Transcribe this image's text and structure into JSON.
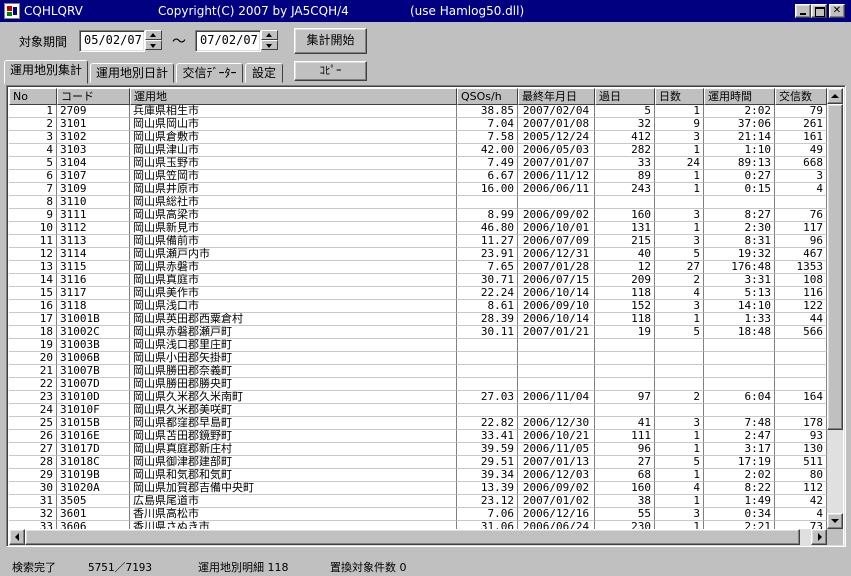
{
  "window": {
    "title": "CQHLQRV",
    "copyright": "Copyright(C) 2007  by  JA5CQH/4",
    "note": "(use Hamlog50.dll)"
  },
  "toolbar": {
    "period_label": "対象期間",
    "date_from": "05/02/07",
    "date_to": "07/02/07",
    "tilde": "～",
    "start_button": "集計開始",
    "copy_button": "ｺﾋﾟｰ"
  },
  "tabs": [
    {
      "label": "運用地別集計",
      "active": true
    },
    {
      "label": "運用地別日計",
      "active": false
    },
    {
      "label": "交信ﾃﾞｰﾀｰ",
      "active": false
    },
    {
      "label": "設定",
      "active": false
    }
  ],
  "table": {
    "columns": [
      "No",
      "コード",
      "運用地",
      "QSOs/h",
      "最終年月日",
      "過日",
      "日数",
      "運用時間",
      "交信数"
    ],
    "rows": [
      [
        "1",
        "2709",
        "兵庫県相生市",
        "38.85",
        "2007/02/04",
        "5",
        "1",
        "2:02",
        "79"
      ],
      [
        "2",
        "3101",
        "岡山県岡山市",
        "7.04",
        "2007/01/08",
        "32",
        "9",
        "37:06",
        "261"
      ],
      [
        "3",
        "3102",
        "岡山県倉敷市",
        "7.58",
        "2005/12/24",
        "412",
        "3",
        "21:14",
        "161"
      ],
      [
        "4",
        "3103",
        "岡山県津山市",
        "42.00",
        "2006/05/03",
        "282",
        "1",
        "1:10",
        "49"
      ],
      [
        "5",
        "3104",
        "岡山県玉野市",
        "7.49",
        "2007/01/07",
        "33",
        "24",
        "89:13",
        "668"
      ],
      [
        "6",
        "3107",
        "岡山県笠岡市",
        "6.67",
        "2006/11/12",
        "89",
        "1",
        "0:27",
        "3"
      ],
      [
        "7",
        "3109",
        "岡山県井原市",
        "16.00",
        "2006/06/11",
        "243",
        "1",
        "0:15",
        "4"
      ],
      [
        "8",
        "3110",
        "岡山県総社市",
        "",
        "",
        "",
        "",
        "",
        ""
      ],
      [
        "9",
        "3111",
        "岡山県高梁市",
        "8.99",
        "2006/09/02",
        "160",
        "3",
        "8:27",
        "76"
      ],
      [
        "10",
        "3112",
        "岡山県新見市",
        "46.80",
        "2006/10/01",
        "131",
        "1",
        "2:30",
        "117"
      ],
      [
        "11",
        "3113",
        "岡山県備前市",
        "11.27",
        "2006/07/09",
        "215",
        "3",
        "8:31",
        "96"
      ],
      [
        "12",
        "3114",
        "岡山県瀬戸内市",
        "23.91",
        "2006/12/31",
        "40",
        "5",
        "19:32",
        "467"
      ],
      [
        "13",
        "3115",
        "岡山県赤磐市",
        "7.65",
        "2007/01/28",
        "12",
        "27",
        "176:48",
        "1353"
      ],
      [
        "14",
        "3116",
        "岡山県真庭市",
        "30.71",
        "2006/07/15",
        "209",
        "2",
        "3:31",
        "108"
      ],
      [
        "15",
        "3117",
        "岡山県美作市",
        "22.24",
        "2006/10/14",
        "118",
        "4",
        "5:13",
        "116"
      ],
      [
        "16",
        "3118",
        "岡山県浅口市",
        "8.61",
        "2006/09/10",
        "152",
        "3",
        "14:10",
        "122"
      ],
      [
        "17",
        "31001B",
        "岡山県英田郡西粟倉村",
        "28.39",
        "2006/10/14",
        "118",
        "1",
        "1:33",
        "44"
      ],
      [
        "18",
        "31002C",
        "岡山県赤磐郡瀬戸町",
        "30.11",
        "2007/01/21",
        "19",
        "5",
        "18:48",
        "566"
      ],
      [
        "19",
        "31003B",
        "岡山県浅口郡里庄町",
        "",
        "",
        "",
        "",
        "",
        ""
      ],
      [
        "20",
        "31006B",
        "岡山県小田郡矢掛町",
        "",
        "",
        "",
        "",
        "",
        ""
      ],
      [
        "21",
        "31007B",
        "岡山県勝田郡奈義町",
        "",
        "",
        "",
        "",
        "",
        ""
      ],
      [
        "22",
        "31007D",
        "岡山県勝田郡勝央町",
        "",
        "",
        "",
        "",
        "",
        ""
      ],
      [
        "23",
        "31010D",
        "岡山県久米郡久米南町",
        "27.03",
        "2006/11/04",
        "97",
        "2",
        "6:04",
        "164"
      ],
      [
        "24",
        "31010F",
        "岡山県久米郡美咲町",
        "",
        "",
        "",
        "",
        "",
        ""
      ],
      [
        "25",
        "31015B",
        "岡山県都窪郡早島町",
        "22.82",
        "2006/12/30",
        "41",
        "3",
        "7:48",
        "178"
      ],
      [
        "26",
        "31016E",
        "岡山県苫田郡鏡野町",
        "33.41",
        "2006/10/21",
        "111",
        "1",
        "2:47",
        "93"
      ],
      [
        "27",
        "31017D",
        "岡山県真庭郡新庄村",
        "39.59",
        "2006/11/05",
        "96",
        "1",
        "3:17",
        "130"
      ],
      [
        "28",
        "31018C",
        "岡山県御津郡建部町",
        "29.51",
        "2007/01/13",
        "27",
        "5",
        "17:19",
        "511"
      ],
      [
        "29",
        "31019B",
        "岡山県和気郡和気町",
        "39.34",
        "2006/12/03",
        "68",
        "1",
        "2:02",
        "80"
      ],
      [
        "30",
        "31020A",
        "岡山県加賀郡吉備中央町",
        "13.39",
        "2006/09/02",
        "160",
        "4",
        "8:22",
        "112"
      ],
      [
        "31",
        "3505",
        "広島県尾道市",
        "23.12",
        "2007/01/02",
        "38",
        "1",
        "1:49",
        "42"
      ],
      [
        "32",
        "3601",
        "香川県高松市",
        "7.06",
        "2006/12/16",
        "55",
        "3",
        "0:34",
        "4"
      ],
      [
        "33",
        "3606",
        "香川県さぬき市",
        "31.06",
        "2006/06/24",
        "230",
        "1",
        "2:21",
        "73"
      ]
    ]
  },
  "status": {
    "search": "検索完了",
    "count": "5751／7193",
    "detail": "運用地別明細 118",
    "replace": "置換対象件数 0"
  }
}
